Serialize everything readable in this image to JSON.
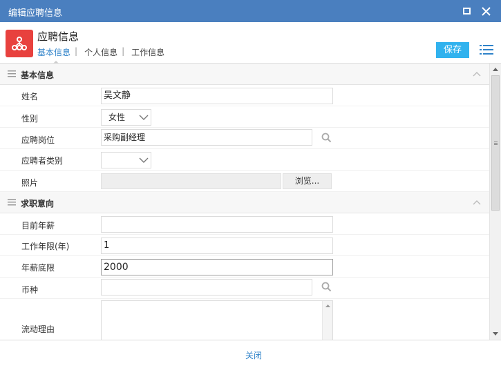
{
  "window": {
    "title": "编辑应聘信息"
  },
  "header": {
    "title": "应聘信息",
    "tabs": [
      {
        "label": "基本信息",
        "active": true
      },
      {
        "label": "个人信息",
        "active": false
      },
      {
        "label": "工作信息",
        "active": false
      }
    ],
    "save_label": "保存"
  },
  "sections": {
    "basic": {
      "title": "基本信息",
      "fields": {
        "name": {
          "label": "姓名",
          "value": "吴文静"
        },
        "gender": {
          "label": "性别",
          "value": "女性"
        },
        "position": {
          "label": "应聘岗位",
          "value": "采购副经理"
        },
        "applicant_type": {
          "label": "应聘者类别",
          "value": ""
        },
        "photo": {
          "label": "照片",
          "browse_label": "浏览..."
        }
      }
    },
    "intent": {
      "title": "求职意向",
      "fields": {
        "current_salary": {
          "label": "目前年薪",
          "value": ""
        },
        "years": {
          "label": "工作年限(年)",
          "value": "1"
        },
        "min_salary": {
          "label": "年薪底限",
          "value": "2000"
        },
        "currency": {
          "label": "币种",
          "value": ""
        },
        "reason": {
          "label": "流动理由",
          "value": ""
        }
      }
    }
  },
  "footer": {
    "close_label": "关闭"
  },
  "colors": {
    "titlebar": "#4a7fbf",
    "accent": "#31b2ee",
    "icon_bg": "#e8413e",
    "link": "#2e82c9"
  }
}
